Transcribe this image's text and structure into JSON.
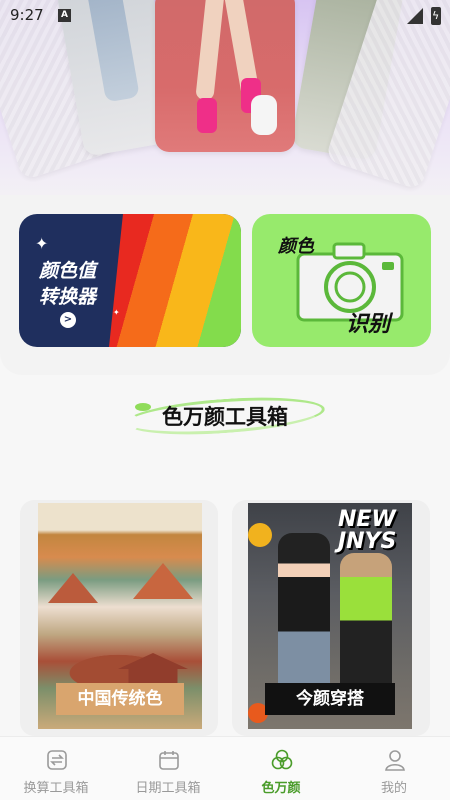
{
  "status_bar": {
    "time": "9:27",
    "notification_letter": "A"
  },
  "features": {
    "converter": {
      "line1": "颜色值",
      "line2": "转换器",
      "go_symbol": ">"
    },
    "recognition": {
      "word1": "颜色",
      "word2": "识别"
    }
  },
  "section": {
    "title": "色万颜工具箱"
  },
  "tiles": [
    {
      "label": "中国传统色"
    },
    {
      "label": "今颜穿搭",
      "graffiti_line1": "NEW",
      "graffiti_line2": "JNYS"
    }
  ],
  "bottom_nav": {
    "items": [
      {
        "label": "换算工具箱",
        "icon": "exchange-icon"
      },
      {
        "label": "日期工具箱",
        "icon": "calendar-icon"
      },
      {
        "label": "色万颜",
        "icon": "color-circles-icon",
        "active": true
      },
      {
        "label": "我的",
        "icon": "user-icon"
      }
    ],
    "active_color": "#4a9c2a",
    "inactive_color": "#9a9a9a"
  }
}
